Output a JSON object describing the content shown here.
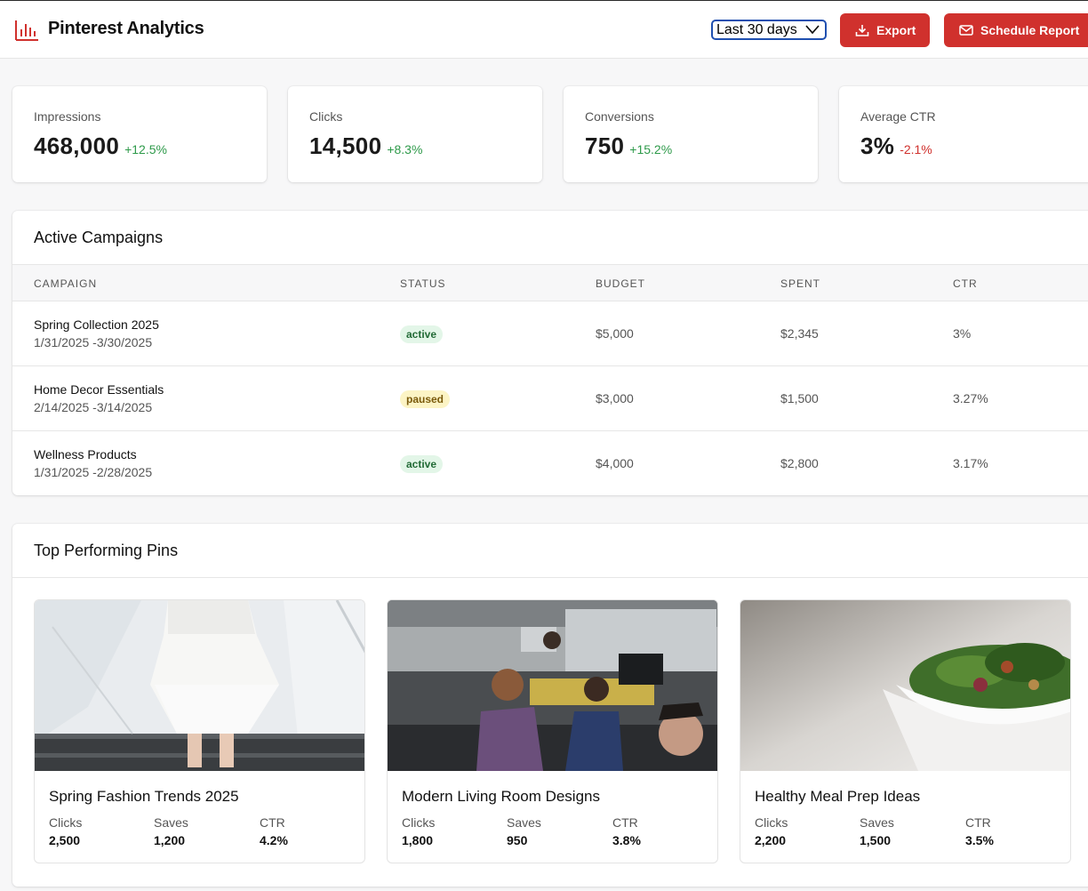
{
  "app": {
    "title": "Pinterest Analytics"
  },
  "header": {
    "date_range": "Last 30 days",
    "export_label": "Export",
    "schedule_label": "Schedule Report",
    "accent_color": "#d0312d"
  },
  "metrics": [
    {
      "label": "Impressions",
      "value": "468,000",
      "change": "+12.5%",
      "trend": "up"
    },
    {
      "label": "Clicks",
      "value": "14,500",
      "change": "+8.3%",
      "trend": "up"
    },
    {
      "label": "Conversions",
      "value": "750",
      "change": "+15.2%",
      "trend": "up"
    },
    {
      "label": "Average CTR",
      "value": "3%",
      "change": "-2.1%",
      "trend": "down"
    }
  ],
  "campaigns": {
    "title": "Active Campaigns",
    "columns": [
      "CAMPAIGN",
      "STATUS",
      "BUDGET",
      "SPENT",
      "CTR"
    ],
    "rows": [
      {
        "name": "Spring Collection 2025",
        "dates": "1/31/2025 -3/30/2025",
        "status": "active",
        "budget": "$5,000",
        "spent": "$2,345",
        "ctr": "3%"
      },
      {
        "name": "Home Decor Essentials",
        "dates": "2/14/2025 -3/14/2025",
        "status": "paused",
        "budget": "$3,000",
        "spent": "$1,500",
        "ctr": "3.27%"
      },
      {
        "name": "Wellness Products",
        "dates": "1/31/2025 -2/28/2025",
        "status": "active",
        "budget": "$4,000",
        "spent": "$2,800",
        "ctr": "3.17%"
      }
    ]
  },
  "pins": {
    "title": "Top Performing Pins",
    "stat_labels": {
      "clicks": "Clicks",
      "saves": "Saves",
      "ctr": "CTR"
    },
    "items": [
      {
        "title": "Spring Fashion Trends 2025",
        "clicks": "2,500",
        "saves": "1,200",
        "ctr": "4.2%"
      },
      {
        "title": "Modern Living Room Designs",
        "clicks": "1,800",
        "saves": "950",
        "ctr": "3.8%"
      },
      {
        "title": "Healthy Meal Prep Ideas",
        "clicks": "2,200",
        "saves": "1,500",
        "ctr": "3.5%"
      }
    ]
  }
}
